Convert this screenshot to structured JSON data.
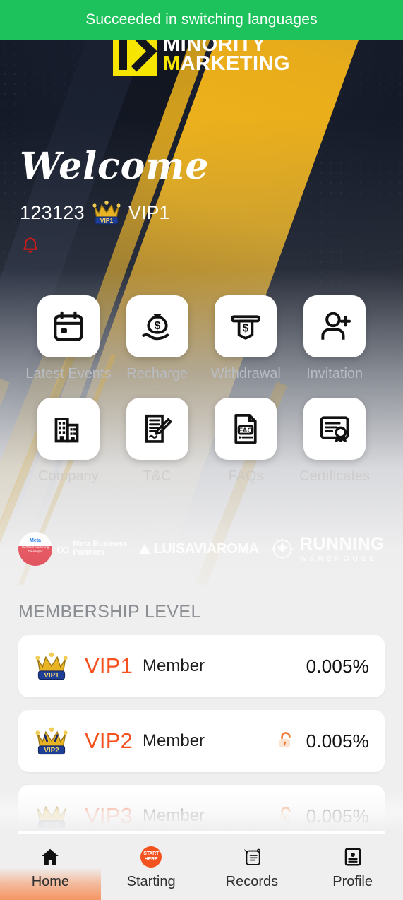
{
  "toast": {
    "message": "Succeeded in switching languages",
    "color": "#1ec25c"
  },
  "brand": {
    "logo_icon": "m-monogram-icon",
    "line1": "MINORITY",
    "line2_accent": "M",
    "line2_rest": "ARKETING",
    "accent_color": "#f6e500"
  },
  "hero": {
    "welcome": "Welcome",
    "username": "123123",
    "vip_badge_icon": "vip1-crown-icon",
    "vip_level": "VIP1",
    "notification_icon": "bell-icon",
    "notification_color": "#d32020"
  },
  "quick_actions": [
    {
      "icon": "calendar-icon",
      "label": "Latest Events"
    },
    {
      "icon": "money-bag-icon",
      "label": "Recharge"
    },
    {
      "icon": "atm-cash-icon",
      "label": "Withdrawal"
    },
    {
      "icon": "person-add-icon",
      "label": "Invitation"
    },
    {
      "icon": "buildings-icon",
      "label": "Company"
    },
    {
      "icon": "contract-pen-icon",
      "label": "T&C"
    },
    {
      "icon": "faq-document-icon",
      "label": "FAQs"
    },
    {
      "icon": "certificate-icon",
      "label": "Certificates"
    }
  ],
  "partners": [
    {
      "seal_top": "Meta",
      "seal_bottom": "Certified Marketing Developer",
      "name_line1": "Meta Business",
      "name_line2": "Partners",
      "icon": "meta-infinity-icon"
    },
    {
      "name_line1": "LUISAVIAROMA",
      "icon": "triangle-icon"
    },
    {
      "name_line1": "RUNNING",
      "name_line2": "WAREHOUSE",
      "icon": "compass-icon"
    }
  ],
  "membership": {
    "title": "MEMBERSHIP LEVEL",
    "levels": [
      {
        "badge": "vip1-crown-icon",
        "name": "VIP1",
        "role": "Member",
        "locked": false,
        "lock_icon": "",
        "rate": "0.005%"
      },
      {
        "badge": "vip2-crown-icon",
        "name": "VIP2",
        "role": "Member",
        "locked": true,
        "lock_icon": "unlock-icon",
        "rate": "0.005%"
      },
      {
        "badge": "vip3-crown-icon",
        "name": "VIP3",
        "role": "Member",
        "locked": true,
        "lock_icon": "unlock-icon",
        "rate": "0.005%"
      }
    ],
    "name_color": "#f4511e"
  },
  "bottom_nav": {
    "active_index": 0,
    "active_color": "#f59562",
    "items": [
      {
        "icon": "home-icon",
        "label": "Home"
      },
      {
        "icon": "start-here-badge-icon",
        "label": "Starting",
        "badge_line1": "START",
        "badge_line2": "HERE"
      },
      {
        "icon": "scroll-pen-icon",
        "label": "Records"
      },
      {
        "icon": "id-card-icon",
        "label": "Profile"
      }
    ]
  }
}
